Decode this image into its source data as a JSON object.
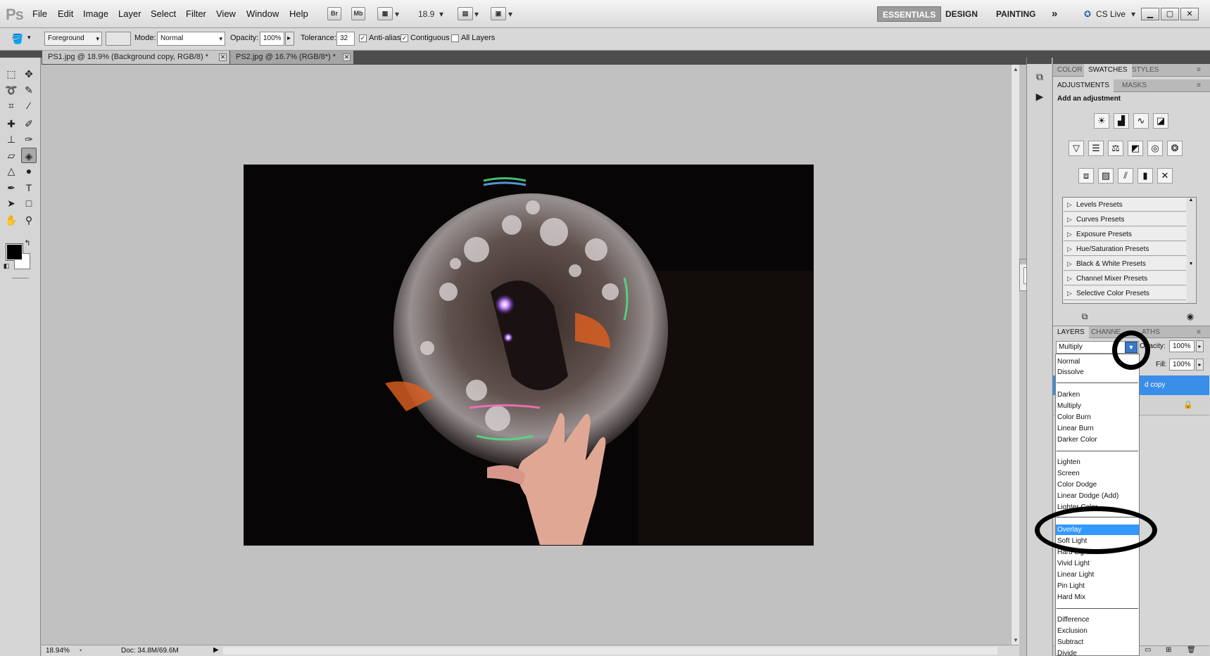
{
  "app": {
    "logo_text": "Ps"
  },
  "menu": [
    "File",
    "Edit",
    "Image",
    "Layer",
    "Select",
    "Filter",
    "View",
    "Window",
    "Help"
  ],
  "appbar": {
    "bridge_label": "Br",
    "minibridge_label": "Mb",
    "zoom_value": "18.9",
    "workspaces": [
      "ESSENTIALS",
      "DESIGN",
      "PAINTING"
    ],
    "overflow": "»",
    "cslive": "CS Live"
  },
  "options": {
    "fill_source": "Foreground",
    "mode_label": "Mode:",
    "mode_value": "Normal",
    "opacity_label": "Opacity:",
    "opacity_value": "100%",
    "tolerance_label": "Tolerance:",
    "tolerance_value": "32",
    "antialias_label": "Anti-alias",
    "contiguous_label": "Contiguous",
    "alllayers_label": "All Layers"
  },
  "tabs": [
    {
      "label": "PS1.jpg @ 18.9% (Background copy, RGB/8) *",
      "active": true
    },
    {
      "label": "PS2.jpg @ 16.7% (RGB/8*) *",
      "active": false
    }
  ],
  "status": {
    "zoom": "18.94%",
    "doc": "Doc: 34.8M/69.6M"
  },
  "panels": {
    "top_tabs": [
      "COLOR",
      "SWATCHES",
      "STYLES"
    ],
    "adj_tabs": [
      "ADJUSTMENTS",
      "MASKS"
    ],
    "adj_title": "Add an adjustment",
    "presets": [
      "Levels Presets",
      "Curves Presets",
      "Exposure Presets",
      "Hue/Saturation Presets",
      "Black & White Presets",
      "Channel Mixer Presets",
      "Selective Color Presets"
    ],
    "layer_tabs": [
      "LAYERS",
      "CHANNELS",
      "PATHS"
    ],
    "layer_tab_visible": [
      "LAYERS",
      "CHANNE",
      "ATHS"
    ],
    "opacity_label": "Opacity:",
    "opacity_value": "100%",
    "fill_label": "Fill:",
    "fill_value": "100%",
    "layer_name_visible": "d copy"
  },
  "blend": {
    "current": "Multiply",
    "groups": [
      [
        "Normal",
        "Dissolve"
      ],
      [
        "Darken",
        "Multiply",
        "Color Burn",
        "Linear Burn",
        "Darker Color"
      ],
      [
        "Lighten",
        "Screen",
        "Color Dodge",
        "Linear Dodge (Add)",
        "Lighter Color"
      ],
      [
        "Overlay",
        "Soft Light",
        "Hard Light",
        "Vivid Light",
        "Linear Light",
        "Pin Light",
        "Hard Mix"
      ],
      [
        "Difference",
        "Exclusion",
        "Subtract",
        "Divide"
      ]
    ],
    "highlighted": "Overlay"
  },
  "colors": {
    "accent": "#3399ff",
    "dropdown_arrow": "#3a78c9",
    "selected_layer": "#3b8ee8",
    "workspace_active": "#9b9b9b"
  },
  "icons": {
    "bucket": "paint-bucket-icon",
    "marquee": "rect-marquee-icon",
    "move": "move-icon"
  }
}
